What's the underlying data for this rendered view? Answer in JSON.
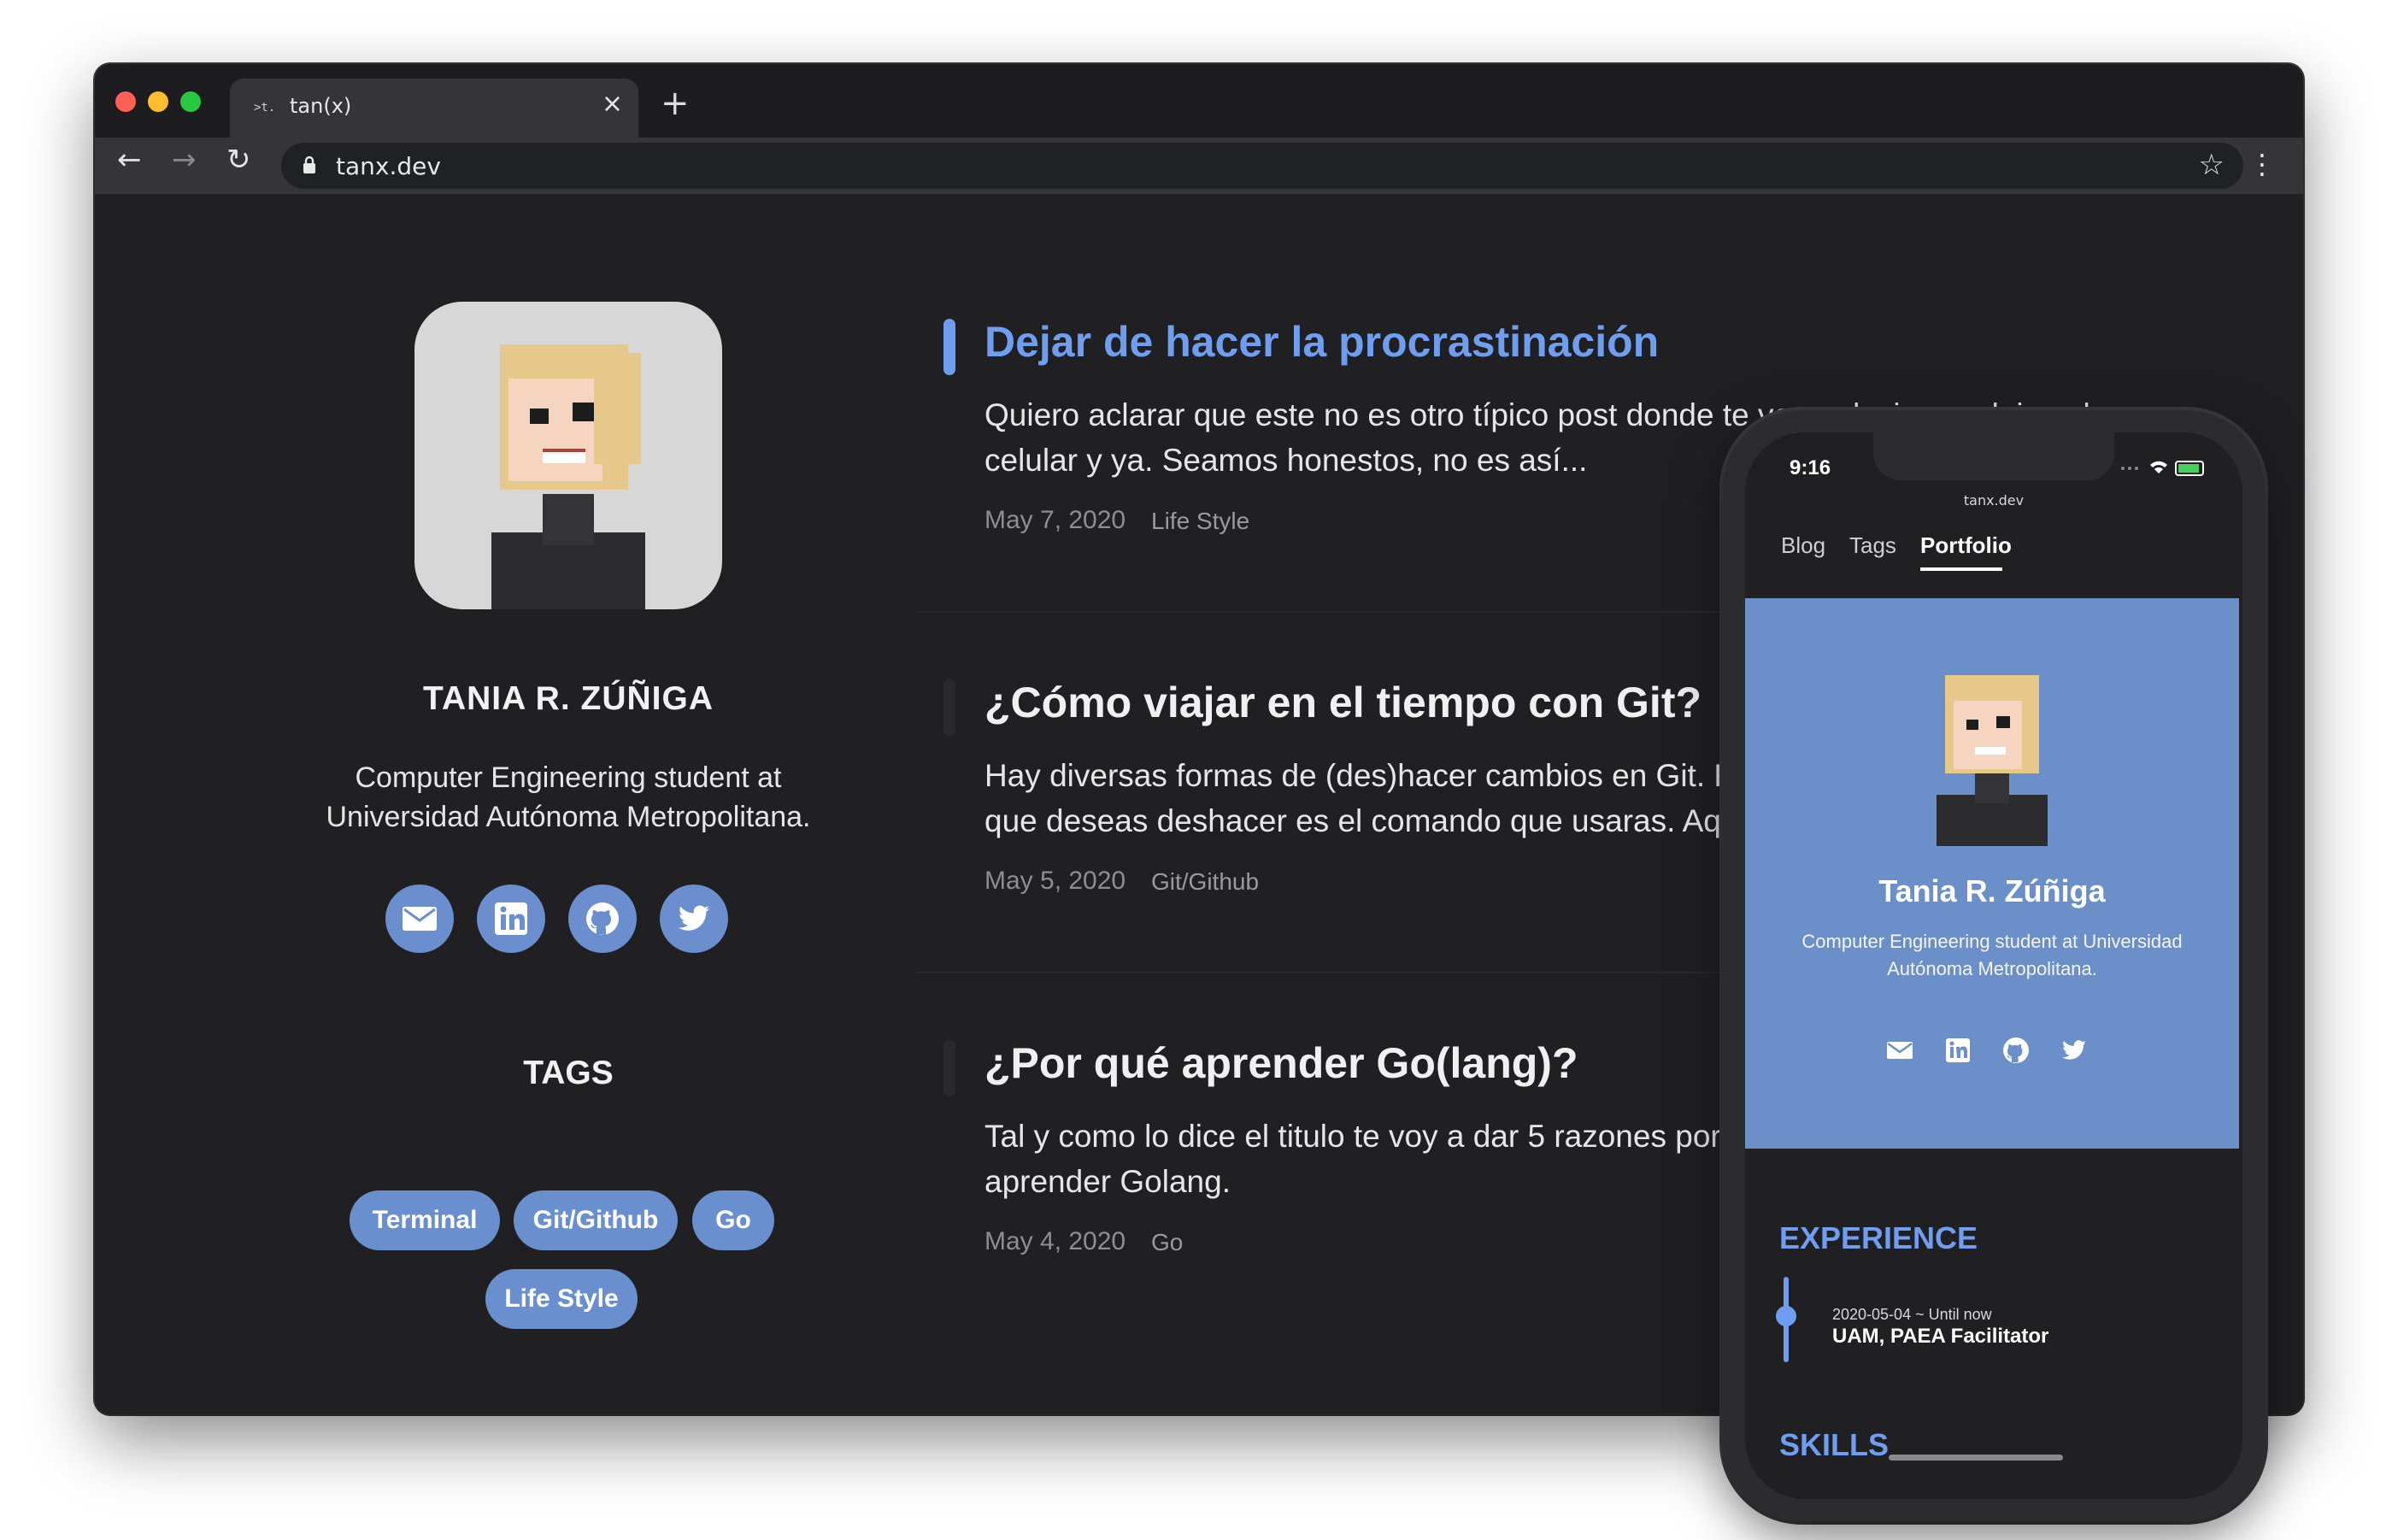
{
  "browser": {
    "tab_title": "tan(x)",
    "tab_favicon": ">t.",
    "tab_close": "×",
    "new_tab": "+",
    "url": "tanx.dev",
    "back": "←",
    "forward": "→",
    "reload": "↻",
    "bookmark": "☆",
    "menu": "⋮",
    "traffic_lights": [
      "#ff5f57",
      "#febc2e",
      "#28c840"
    ]
  },
  "sidebar": {
    "name": "TANIA R. ZÚÑIGA",
    "bio": "Computer Engineering student at Universidad Autónoma Metropolitana.",
    "social": [
      "email-icon",
      "linkedin-icon",
      "github-icon",
      "twitter-icon"
    ],
    "tags_title": "TAGS",
    "tags": [
      "Terminal",
      "Git/Github",
      "Go",
      "Life Style"
    ]
  },
  "posts": [
    {
      "title": "Dejar de hacer la procrastinación",
      "excerpt": "Quiero aclarar que este no es otro típico post donde te voy a decir que dejes el celular y ya. Seamos honestos, no es así...",
      "date": "May 7, 2020",
      "tag": "Life Style"
    },
    {
      "title": "¿Cómo viajar en el tiempo con Git?",
      "excerpt": "Hay diversas formas de (des)hacer cambios en Git. Pero dependiendo de lo que deseas deshacer es el comando que usaras. Aquí te dejo...",
      "date": "May 5, 2020",
      "tag": "Git/Github"
    },
    {
      "title": "¿Por qué aprender Go(lang)?",
      "excerpt": "Tal y como lo dice el titulo te voy a dar 5 razones por las que deberías aprender Golang.",
      "date": "May 4, 2020",
      "tag": "Go"
    }
  ],
  "phone": {
    "time": "9:16",
    "url": "tanx.dev",
    "nav": [
      "Blog",
      "Tags",
      "Portfolio"
    ],
    "name": "Tania R. Zúñiga",
    "bio": "Computer Engineering student at Universidad Autónoma Metropolitana.",
    "experience_title": "EXPERIENCE",
    "experience_date": "2020-05-04 ~ Until now",
    "experience_role": "UAM, PAEA Facilitator",
    "skills_title": "SKILLS"
  },
  "colors": {
    "accent": "#6f9ef0",
    "tag_bg": "#6a8fcf",
    "page_bg": "#202022"
  }
}
